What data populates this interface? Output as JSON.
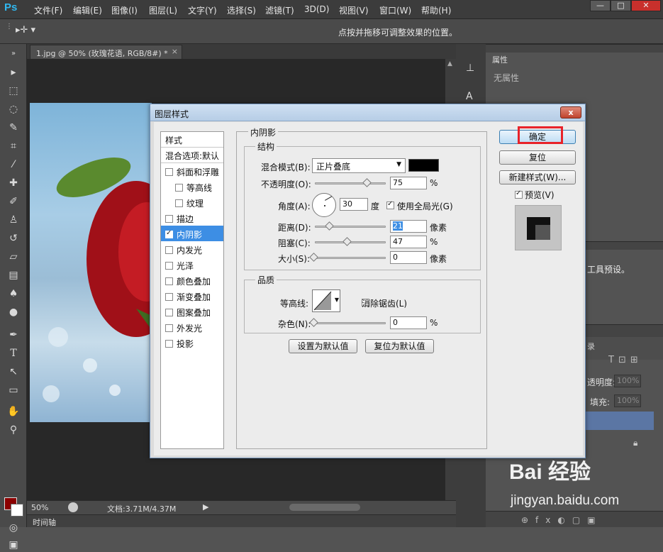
{
  "app": {
    "logo": "Ps"
  },
  "menubar": {
    "items": [
      "文件(F)",
      "编辑(E)",
      "图像(I)",
      "图层(L)",
      "文字(Y)",
      "选择(S)",
      "滤镜(T)",
      "3D(D)",
      "视图(V)",
      "窗口(W)",
      "帮助(H)"
    ],
    "window_buttons": [
      "—",
      "□",
      "✕"
    ]
  },
  "options_bar": {
    "hint": "点按并拖移可调整效果的位置。"
  },
  "document": {
    "tab_label": "1.jpg @ 50% (玫瑰花语, RGB/8#) *",
    "close": "×"
  },
  "status": {
    "zoom": "50%",
    "doc_info": "文档:3.71M/4.37M",
    "timeline": "时间轴"
  },
  "right_panel": {
    "properties_tab": "属性",
    "no_properties": "无属性",
    "tool_presets_text": "工具预设。",
    "layers_tab": "录",
    "opacity_label": "透明度:",
    "opacity_value": "100%",
    "fill_label": "填充:",
    "fill_value": "100%"
  },
  "dialog": {
    "title": "图层样式",
    "close": "x",
    "style_list": {
      "header": "样式",
      "blend_options": "混合选项:默认",
      "items": [
        {
          "label": "斜面和浮雕",
          "checked": false,
          "sub": false,
          "selected": false
        },
        {
          "label": "等高线",
          "checked": false,
          "sub": true,
          "selected": false
        },
        {
          "label": "纹理",
          "checked": false,
          "sub": true,
          "selected": false
        },
        {
          "label": "描边",
          "checked": false,
          "sub": false,
          "selected": false
        },
        {
          "label": "内阴影",
          "checked": true,
          "sub": false,
          "selected": true
        },
        {
          "label": "内发光",
          "checked": false,
          "sub": false,
          "selected": false
        },
        {
          "label": "光泽",
          "checked": false,
          "sub": false,
          "selected": false
        },
        {
          "label": "颜色叠加",
          "checked": false,
          "sub": false,
          "selected": false
        },
        {
          "label": "渐变叠加",
          "checked": false,
          "sub": false,
          "selected": false
        },
        {
          "label": "图案叠加",
          "checked": false,
          "sub": false,
          "selected": false
        },
        {
          "label": "外发光",
          "checked": false,
          "sub": false,
          "selected": false
        },
        {
          "label": "投影",
          "checked": false,
          "sub": false,
          "selected": false
        }
      ]
    },
    "inner_shadow": {
      "group_title": "内阴影",
      "structure_title": "结构",
      "blend_mode_label": "混合模式(B):",
      "blend_mode_value": "正片叠底",
      "shadow_color": "#000000",
      "opacity_label": "不透明度(O):",
      "opacity_value": "75",
      "opacity_unit": "%",
      "angle_label": "角度(A):",
      "angle_value": "30",
      "angle_unit": "度",
      "global_light_label": "使用全局光(G)",
      "global_light_checked": true,
      "distance_label": "距离(D):",
      "distance_value": "21",
      "distance_unit": "像素",
      "choke_label": "阻塞(C):",
      "choke_value": "47",
      "choke_unit": "%",
      "size_label": "大小(S):",
      "size_value": "0",
      "size_unit": "像素"
    },
    "quality": {
      "title": "品质",
      "contour_label": "等高线:",
      "anti_alias_label": "消除锯齿(L)",
      "noise_label": "杂色(N):",
      "noise_value": "0",
      "noise_unit": "%"
    },
    "buttons": {
      "set_default": "设置为默认值",
      "reset_default": "复位为默认值",
      "ok": "确定",
      "reset": "复位",
      "new_style": "新建样式(W)...",
      "preview": "预览(V)"
    }
  },
  "watermark": {
    "brand": "Bai 经验",
    "url": "jingyan.baidu.com"
  }
}
